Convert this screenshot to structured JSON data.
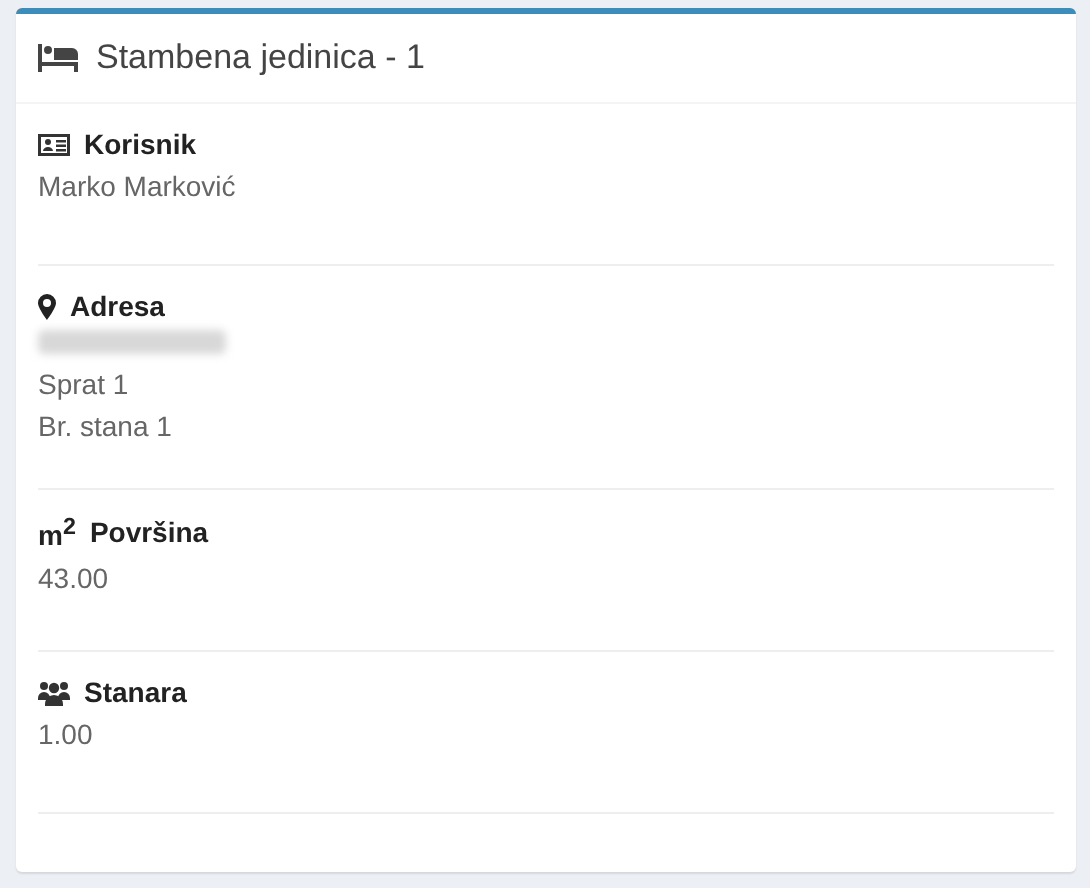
{
  "card": {
    "title": "Stambena jedinica - 1"
  },
  "sections": [
    {
      "label": "Korisnik",
      "lines": [
        {
          "kind": "text",
          "text": "Marko Marković"
        }
      ]
    },
    {
      "label": "Adresa",
      "lines": [
        {
          "kind": "redacted"
        },
        {
          "kind": "text",
          "text": "Sprat 1"
        },
        {
          "kind": "text",
          "text": "Br. stana 1"
        }
      ]
    },
    {
      "unit": "m$^{2}$",
      "label": "Površina",
      "lines": [
        {
          "kind": "text",
          "text": "43.00"
        }
      ]
    },
    {
      "label": "Stanara",
      "lines": [
        {
          "kind": "text",
          "text": "1.00"
        }
      ]
    }
  ]
}
